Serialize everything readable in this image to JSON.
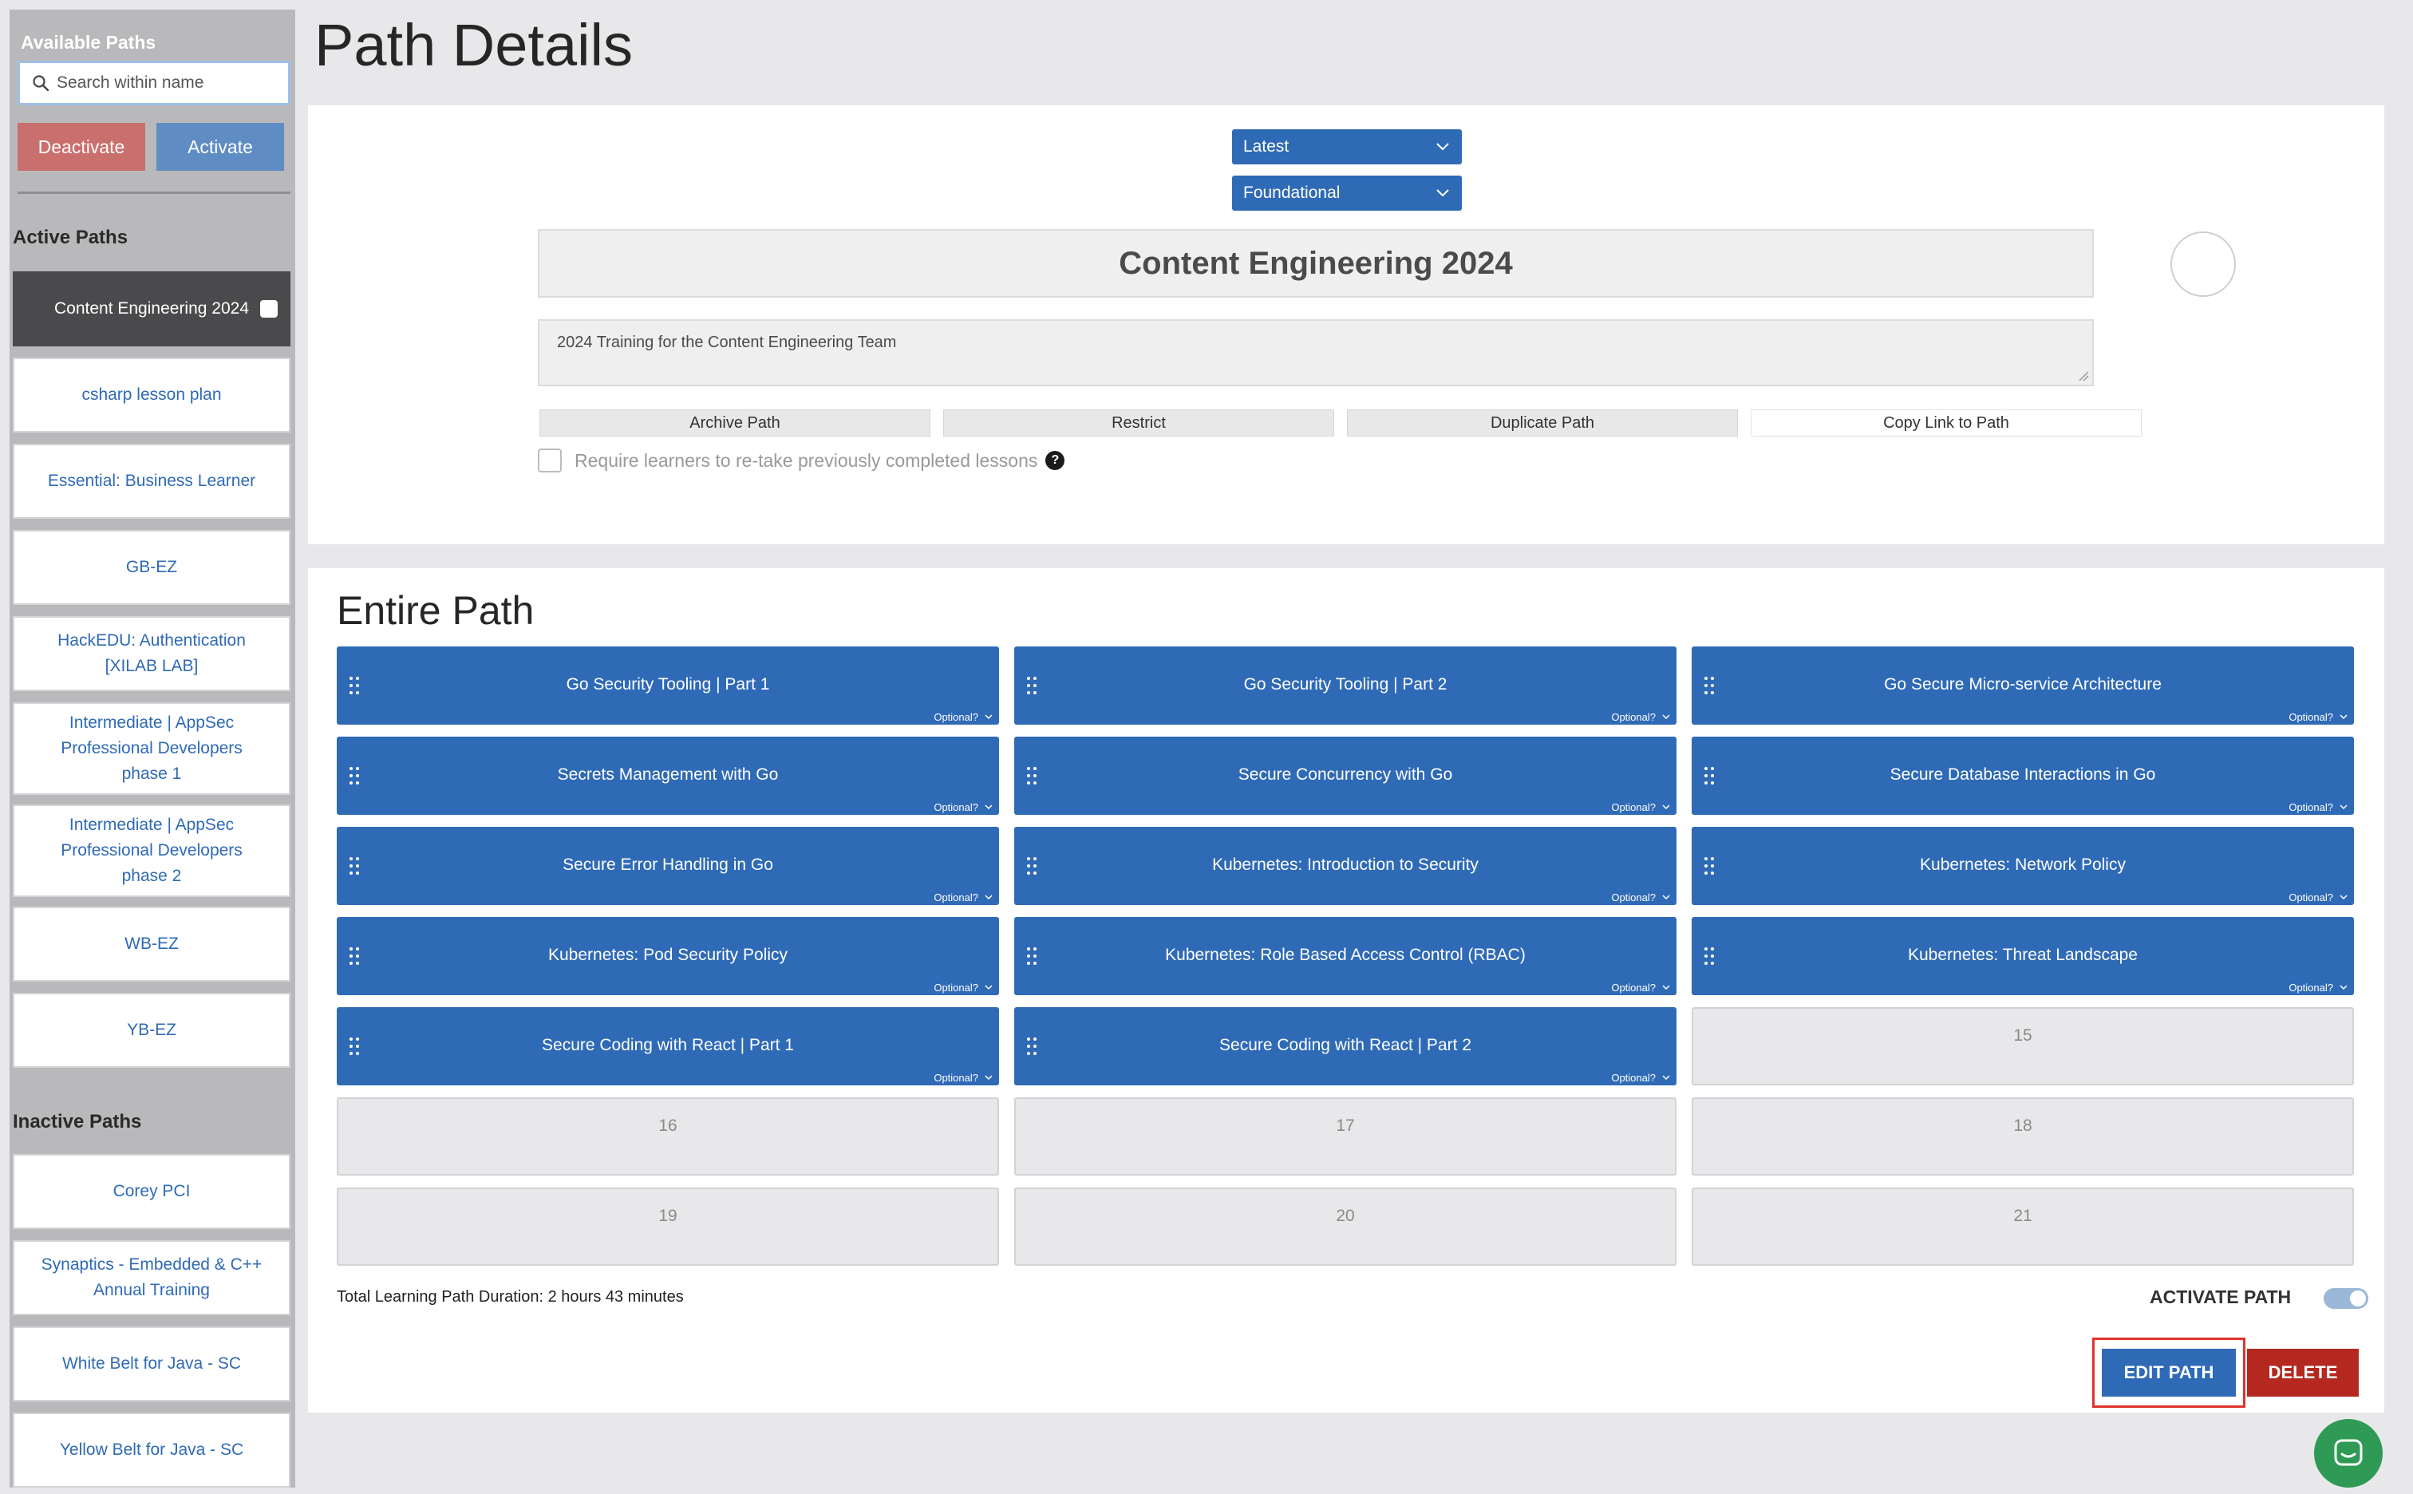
{
  "sidebar": {
    "title": "Available Paths",
    "search": {
      "placeholder": "Search within name",
      "value": ""
    },
    "deactivate_label": "Deactivate",
    "activate_label": "Activate",
    "active_heading": "Active Paths",
    "inactive_heading": "Inactive Paths",
    "active_paths": [
      {
        "label": "Content Engineering 2024",
        "selected": true
      },
      {
        "label": "csharp lesson plan"
      },
      {
        "label": "Essential: Business Learner"
      },
      {
        "label": "GB-EZ"
      },
      {
        "label": "HackEDU: Authentication [XILAB LAB]"
      },
      {
        "label": "Intermediate | AppSec Professional Developers phase 1"
      },
      {
        "label": "Intermediate | AppSec Professional Developers phase 2"
      },
      {
        "label": "WB-EZ"
      },
      {
        "label": "YB-EZ"
      }
    ],
    "inactive_paths": [
      {
        "label": "Corey PCI"
      },
      {
        "label": "Synaptics - Embedded & C++ Annual Training"
      },
      {
        "label": "White Belt for Java - SC"
      },
      {
        "label": "Yellow Belt for Java - SC"
      }
    ]
  },
  "main": {
    "page_title": "Path Details",
    "version_select": "Latest",
    "level_select": "Foundational",
    "path_name": "Content Engineering 2024",
    "description": "2024 Training for the Content Engineering Team",
    "actions": {
      "archive": "Archive Path",
      "restrict": "Restrict",
      "duplicate": "Duplicate Path",
      "copy_link": "Copy Link to Path"
    },
    "retake_label": "Require learners to re-take previously completed lessons",
    "help_glyph": "?",
    "entire_title": "Entire Path",
    "optional_label": "Optional?",
    "lessons": [
      "Go Security Tooling | Part 1",
      "Go Security Tooling | Part 2",
      "Go Secure Micro-service Architecture",
      "Secrets Management with Go",
      "Secure Concurrency with Go",
      "Secure Database Interactions in Go",
      "Secure Error Handling in Go",
      "Kubernetes: Introduction to Security",
      "Kubernetes: Network Policy",
      "Kubernetes: Pod Security Policy",
      "Kubernetes: Role Based Access Control (RBAC)",
      "Kubernetes: Threat Landscape",
      "Secure Coding with React | Part 1",
      "Secure Coding with React | Part 2"
    ],
    "empty_slots": [
      "15",
      "16",
      "17",
      "18",
      "19",
      "20",
      "21"
    ],
    "duration": "Total Learning Path Duration: 2 hours 43 minutes",
    "activate_path_label": "ACTIVATE PATH",
    "activate_path_on": true,
    "edit_label": "EDIT PATH",
    "delete_label": "DELETE"
  },
  "colors": {
    "primary": "#2f6ab6",
    "danger": "#b5281f",
    "deactivate": "#c96f6d",
    "highlight": "#e0332b",
    "chat": "#2f9a55"
  },
  "icons": {
    "search": "search-icon",
    "chevron": "chevron-down-icon",
    "drag": "drag-handle-icon",
    "chat": "chat-icon"
  }
}
